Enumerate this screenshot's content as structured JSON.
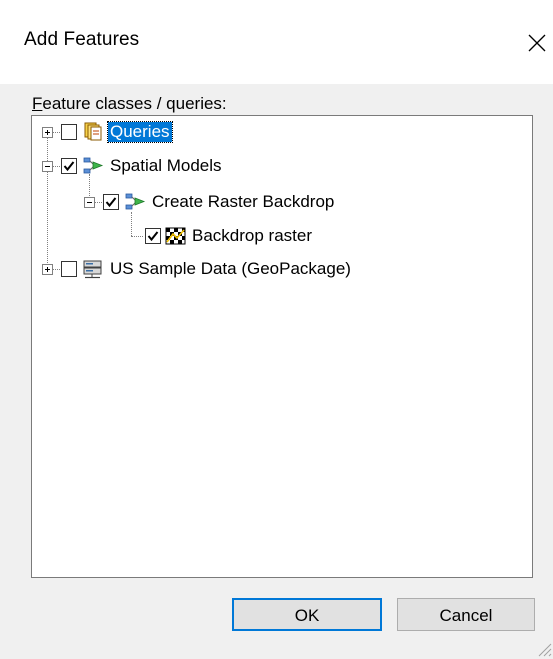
{
  "dialog": {
    "title": "Add Features",
    "close_icon": "close-icon"
  },
  "tree": {
    "label_mnemonic": "F",
    "label_rest": "eature classes / queries:",
    "nodes": {
      "queries": {
        "label": "Queries",
        "checked": false,
        "expanded": false,
        "selected": true,
        "icon": "queries-folder-icon"
      },
      "spatial_models": {
        "label": "Spatial Models",
        "checked": true,
        "expanded": true,
        "icon": "model-icon"
      },
      "create_raster_backdrop": {
        "label": "Create Raster Backdrop",
        "checked": true,
        "expanded": true,
        "icon": "model-icon"
      },
      "backdrop_raster": {
        "label": "Backdrop raster",
        "checked": true,
        "icon": "raster-icon"
      },
      "us_sample_data": {
        "label": "US Sample Data (GeoPackage)",
        "checked": false,
        "expanded": false,
        "icon": "database-icon"
      }
    }
  },
  "buttons": {
    "ok_label": "OK",
    "cancel_label": "Cancel"
  },
  "colors": {
    "selection": "#0078d7",
    "dialog_bg": "#f0f0f0"
  }
}
